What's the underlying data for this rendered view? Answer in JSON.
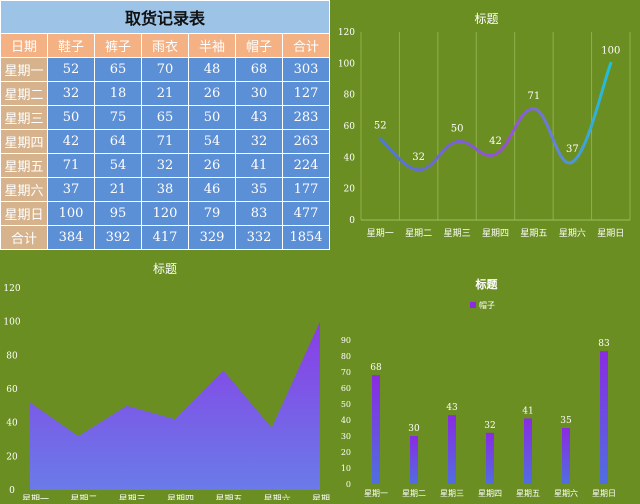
{
  "table": {
    "title": "取货记录表",
    "headers": [
      "日期",
      "鞋子",
      "裤子",
      "雨衣",
      "半袖",
      "帽子",
      "合计"
    ],
    "rows": [
      [
        "星期一",
        "52",
        "65",
        "70",
        "48",
        "68",
        "303"
      ],
      [
        "星期二",
        "32",
        "18",
        "21",
        "26",
        "30",
        "127"
      ],
      [
        "星期三",
        "50",
        "75",
        "65",
        "50",
        "43",
        "283"
      ],
      [
        "星期四",
        "42",
        "64",
        "71",
        "54",
        "32",
        "263"
      ],
      [
        "星期五",
        "71",
        "54",
        "32",
        "26",
        "41",
        "224"
      ],
      [
        "星期六",
        "37",
        "21",
        "38",
        "46",
        "35",
        "177"
      ],
      [
        "星期日",
        "100",
        "95",
        "120",
        "79",
        "83",
        "477"
      ],
      [
        "合计",
        "384",
        "392",
        "417",
        "329",
        "332",
        "1854"
      ]
    ]
  },
  "chart_data": [
    {
      "type": "line",
      "title": "标题",
      "categories": [
        "星期一",
        "星期二",
        "星期三",
        "星期四",
        "星期五",
        "星期六",
        "星期日"
      ],
      "series": [
        {
          "values": [
            52,
            32,
            50,
            42,
            71,
            37,
            100
          ]
        }
      ],
      "ylim": [
        0,
        120
      ],
      "yticks": [
        0,
        20,
        40,
        60,
        80,
        100,
        120
      ],
      "data_labels": true,
      "grid": "vertical",
      "colors": {
        "line_start": "#4a7bd6",
        "line_mid": "#9a4fd6",
        "line_end": "#20c0d8"
      }
    },
    {
      "type": "area",
      "title": "标题",
      "categories": [
        "星期一",
        "星期二",
        "星期三",
        "星期四",
        "星期五",
        "星期六",
        "星期日"
      ],
      "series": [
        {
          "values": [
            52,
            32,
            50,
            42,
            71,
            37,
            100
          ]
        }
      ],
      "ylim": [
        0,
        120
      ],
      "yticks": [
        0,
        20,
        40,
        60,
        80,
        100,
        120
      ],
      "colors": {
        "fill_top": "#8a3de6",
        "fill_bottom": "#6a7be8"
      }
    },
    {
      "type": "bar",
      "title": "标题",
      "legend": {
        "label": "帽子",
        "placement": "top"
      },
      "categories": [
        "星期一",
        "星期二",
        "星期三",
        "星期四",
        "星期五",
        "星期六",
        "星期日"
      ],
      "series": [
        {
          "name": "帽子",
          "values": [
            68,
            30,
            43,
            32,
            41,
            35,
            83
          ]
        }
      ],
      "ylim": [
        0,
        90
      ],
      "yticks": [
        0,
        10,
        20,
        30,
        40,
        50,
        60,
        70,
        80,
        90
      ],
      "data_labels": true,
      "colors": {
        "bar_top": "#8a2be2",
        "bar_bottom": "#4f6fe0"
      }
    }
  ]
}
